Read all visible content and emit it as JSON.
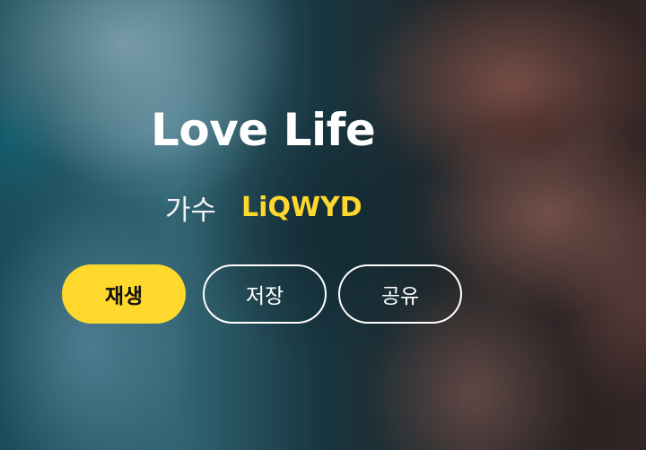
{
  "song": {
    "title": "Love Life",
    "artist_label": "가수",
    "artist_name": "LiQWYD"
  },
  "actions": {
    "play_label": "재생",
    "save_label": "저장",
    "share_label": "공유"
  },
  "colors": {
    "accent": "#ffd82d",
    "text": "#ffffff",
    "play_text": "#111111"
  }
}
